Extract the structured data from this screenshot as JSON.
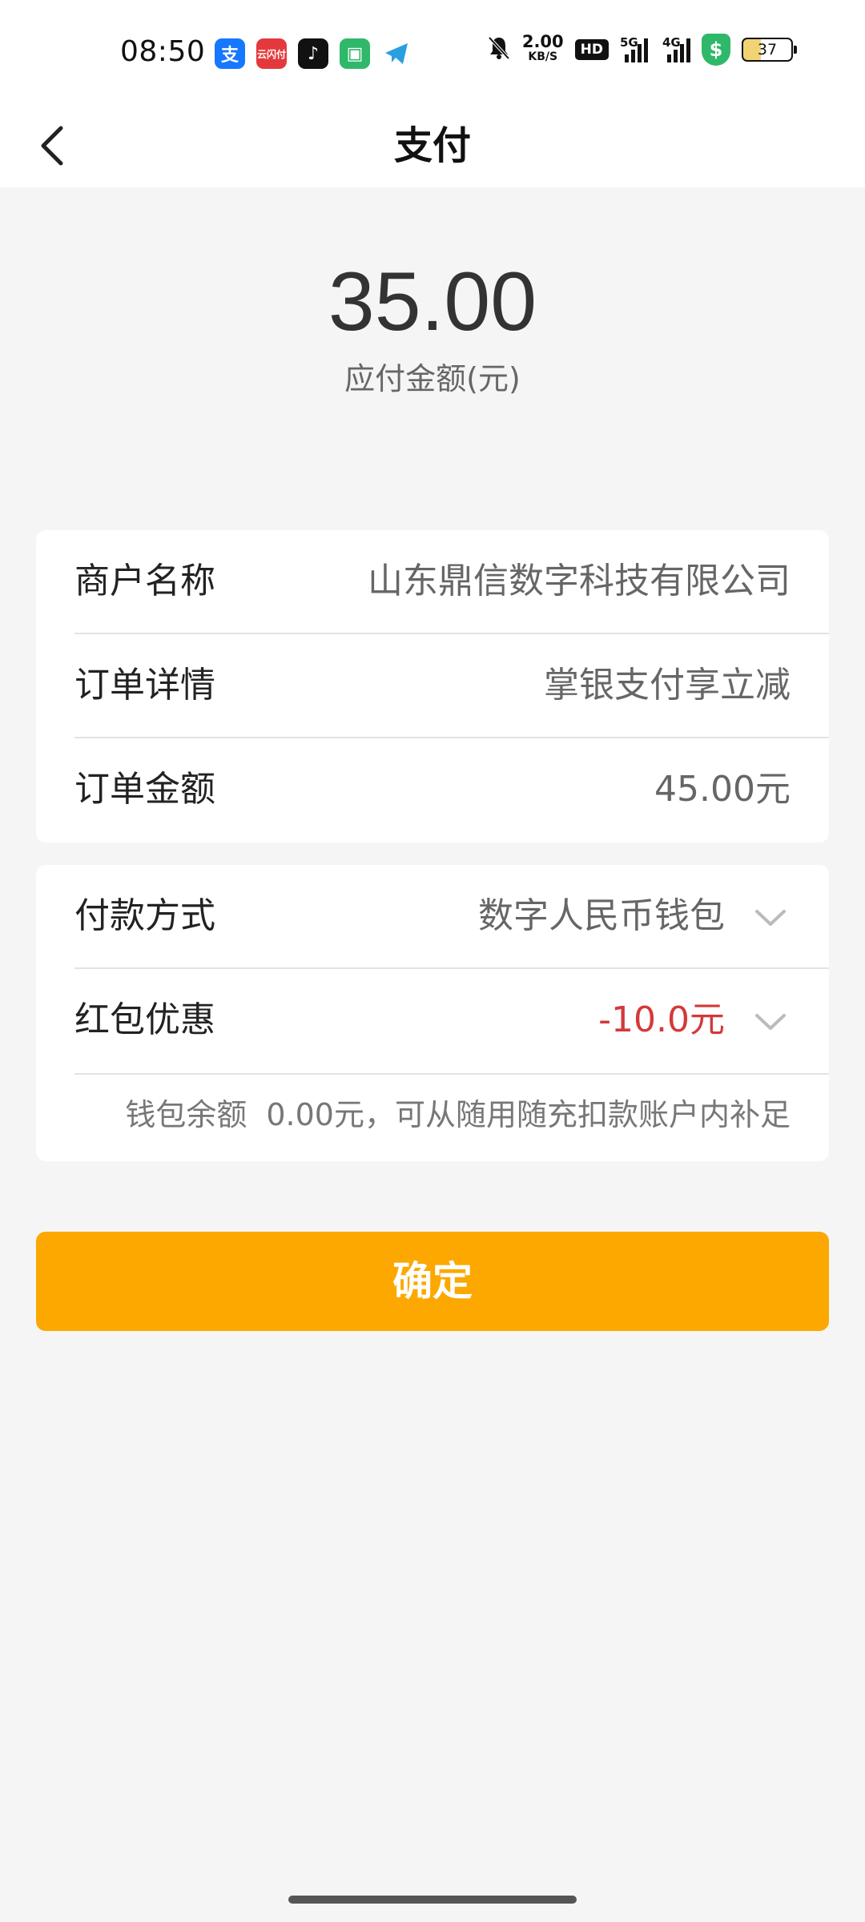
{
  "status_bar": {
    "time": "08:50",
    "net_speed_value": "2.00",
    "net_speed_unit": "KB/S",
    "hd_label": "HD",
    "signal1_label": "5G",
    "signal2_label": "4G",
    "battery_level": "37",
    "app_icons": [
      "alipay-icon",
      "yunshanfu-icon",
      "douyin-icon",
      "security-app-icon",
      "telegram-icon"
    ],
    "status_icons": [
      "mute-bell-icon",
      "shield-dollar-icon"
    ]
  },
  "header": {
    "title": "支付",
    "back_icon": "chevron-left-icon"
  },
  "payment": {
    "amount": "35.00",
    "amount_label": "应付金额(元)"
  },
  "order_card": {
    "rows": [
      {
        "label": "商户名称",
        "value": "山东鼎信数字科技有限公司"
      },
      {
        "label": "订单详情",
        "value": "掌银支付享立减"
      },
      {
        "label": "订单金额",
        "value": "45.00元"
      }
    ]
  },
  "pay_card": {
    "method_label": "付款方式",
    "method_value": "数字人民币钱包",
    "discount_label": "红包优惠",
    "discount_value": "-10.0元",
    "balance_label": "钱包余额",
    "balance_text": "0.00元，可从随用随充扣款账户内补足"
  },
  "confirm_button": "确定",
  "colors": {
    "accent": "#fca800",
    "discount_red": "#d23a3a",
    "page_bg": "#f5f5f5"
  }
}
